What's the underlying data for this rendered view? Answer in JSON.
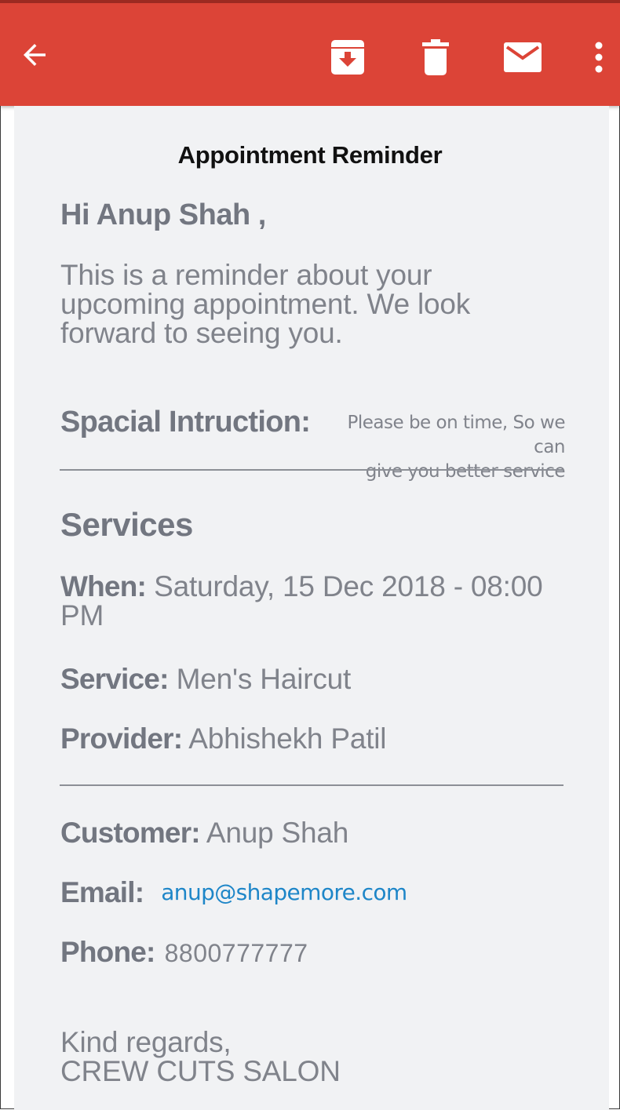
{
  "colors": {
    "toolbar": "#dc4437",
    "link": "#1e86c8",
    "background": "#f1f2f4"
  },
  "toolbar": {
    "icons": [
      "back-arrow-icon",
      "archive-icon",
      "delete-icon",
      "mail-icon",
      "more-vert-icon"
    ]
  },
  "email": {
    "title": "Appointment Reminder",
    "greeting": "Hi Anup Shah ,",
    "intro": "This is a reminder about your upcoming appointment. We look forward to seeing you.",
    "special_instruction": {
      "label": "Spacial Intruction:",
      "value_line1": "Please be on time, So we can",
      "value_line2": "give you better service"
    },
    "services": {
      "heading": "Services",
      "when_label": "When:",
      "when_value": " Saturday, 15 Dec 2018 - 08:00 PM",
      "service_label": "Service:",
      "service_value": " Men's Haircut",
      "provider_label": "Provider:",
      "provider_value": " Abhishekh Patil"
    },
    "customer": {
      "customer_label": "Customer:",
      "customer_value": " Anup Shah",
      "email_label": "Email:",
      "email_value": "anup@shapemore.com",
      "phone_label": "Phone:",
      "phone_value": "8800777777"
    },
    "closing": {
      "line1": "Kind regards,",
      "line2": "CREW CUTS SALON"
    }
  }
}
